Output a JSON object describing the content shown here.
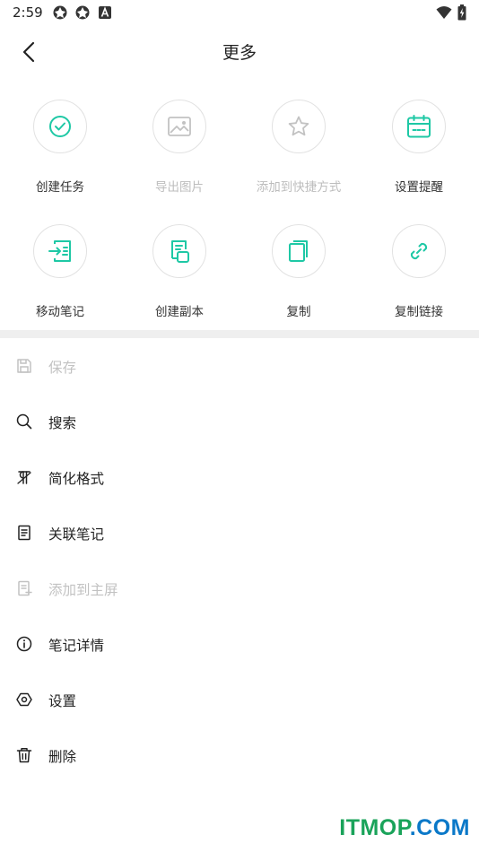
{
  "status_bar": {
    "time": "2:59",
    "icons": [
      "app-notification-icon",
      "app-notification-icon",
      "a-notification-icon",
      "wifi-icon",
      "battery-charging-icon"
    ]
  },
  "header": {
    "title": "更多",
    "back_icon": "chevron-left-icon"
  },
  "accent_color": "#1ec8a5",
  "disabled_color": "#c2c2c2",
  "grid": [
    {
      "label": "创建任务",
      "icon": "check-circle-icon",
      "enabled": true
    },
    {
      "label": "导出图片",
      "icon": "image-icon",
      "enabled": false
    },
    {
      "label": "添加到快捷方式",
      "icon": "star-icon",
      "enabled": false
    },
    {
      "label": "设置提醒",
      "icon": "calendar-icon",
      "enabled": true
    },
    {
      "label": "移动笔记",
      "icon": "move-note-icon",
      "enabled": true
    },
    {
      "label": "创建副本",
      "icon": "duplicate-note-icon",
      "enabled": true
    },
    {
      "label": "复制",
      "icon": "copy-icon",
      "enabled": true
    },
    {
      "label": "复制链接",
      "icon": "link-icon",
      "enabled": true
    }
  ],
  "menu": [
    {
      "label": "保存",
      "icon": "save-icon",
      "enabled": false
    },
    {
      "label": "搜索",
      "icon": "search-icon",
      "enabled": true
    },
    {
      "label": "简化格式",
      "icon": "clear-format-icon",
      "enabled": true
    },
    {
      "label": "关联笔记",
      "icon": "linked-note-icon",
      "enabled": true
    },
    {
      "label": "添加到主屏",
      "icon": "add-to-home-icon",
      "enabled": false
    },
    {
      "label": "笔记详情",
      "icon": "info-icon",
      "enabled": true
    },
    {
      "label": "设置",
      "icon": "settings-icon",
      "enabled": true
    },
    {
      "label": "删除",
      "icon": "trash-icon",
      "enabled": true
    }
  ],
  "watermark": {
    "text_a": "ITMOP",
    "text_b": ".COM",
    "color_a": "#1aa35a",
    "color_b": "#0a78c8"
  }
}
